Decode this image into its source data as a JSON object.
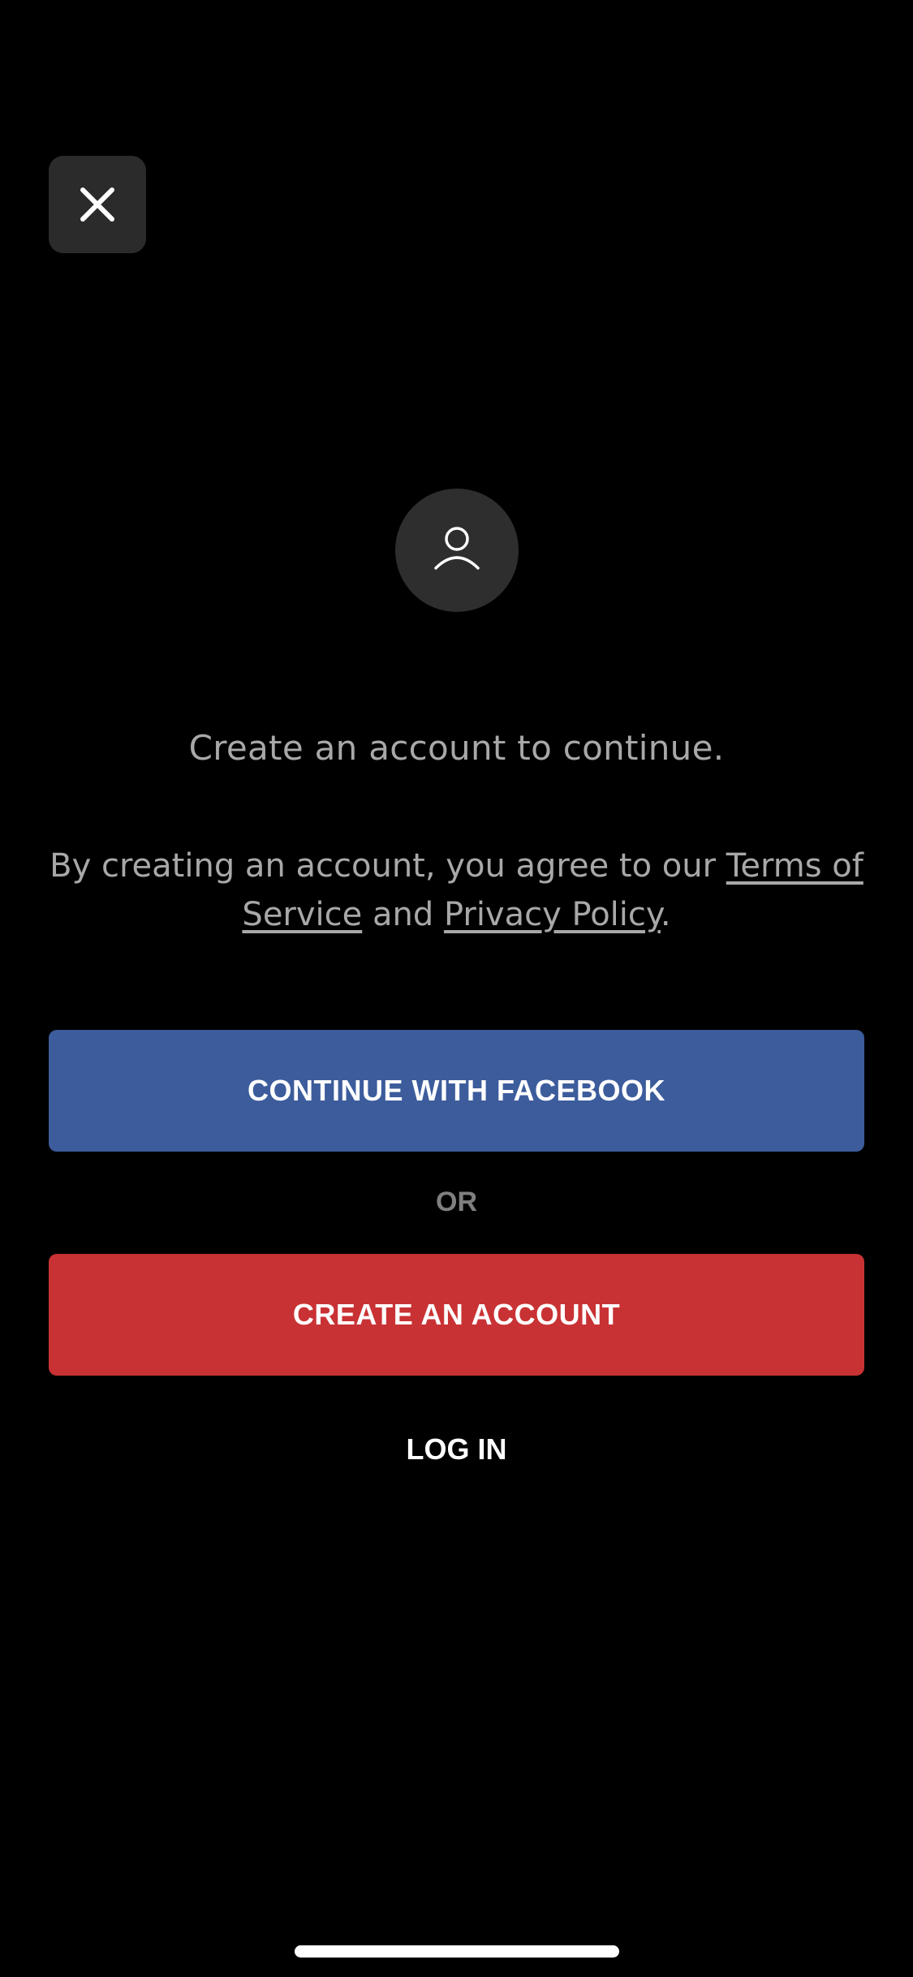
{
  "icons": {
    "close": "close-icon",
    "avatar": "person-icon"
  },
  "colors": {
    "background": "#000000",
    "facebook_button": "#3c5c9c",
    "create_button": "#c93234",
    "secondary_text": "#a8a8a8",
    "divider_text": "#7f7f7f"
  },
  "main": {
    "headline": "Create an account to continue.",
    "legal": {
      "prefix": "By creating an account, you agree to our ",
      "terms_link": "Terms of Service",
      "conjunction": " and ",
      "privacy_link": "Privacy Policy",
      "suffix": "."
    },
    "facebook_button_label": "CONTINUE WITH FACEBOOK",
    "divider_label": "OR",
    "create_account_label": "CREATE AN ACCOUNT",
    "login_label": "LOG IN"
  }
}
